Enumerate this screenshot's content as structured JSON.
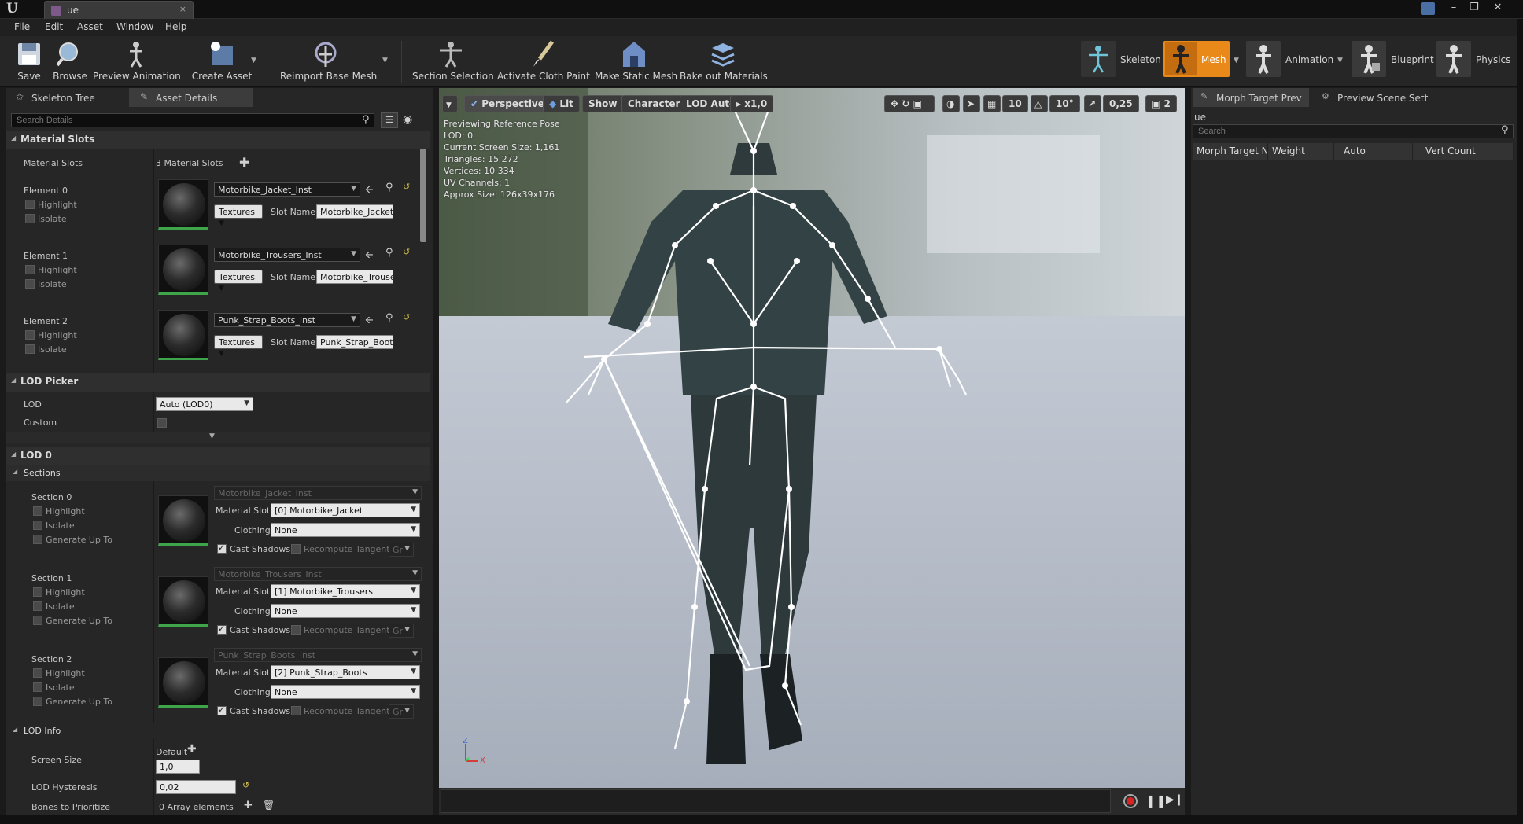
{
  "window": {
    "tab_title": "ue",
    "tab_close": "×",
    "logo": "U",
    "minimize": "–",
    "restore": "❒",
    "close": "✕"
  },
  "menu": [
    "File",
    "Edit",
    "Asset",
    "Window",
    "Help"
  ],
  "toolbar": {
    "buttons": [
      "Save",
      "Browse",
      "Preview Animation",
      "Create Asset",
      "Reimport Base Mesh",
      "Section Selection",
      "Activate Cloth Paint",
      "Make Static Mesh",
      "Bake out Materials"
    ],
    "modes": [
      "Skeleton",
      "Mesh",
      "Animation",
      "Blueprint",
      "Physics"
    ],
    "active_mode": "Mesh",
    "accent_color": "#e8891a"
  },
  "left_panel": {
    "tabs": [
      "Skeleton Tree",
      "Asset Details"
    ],
    "search_placeholder": "Search Details",
    "material_slots": {
      "header": "Material Slots",
      "row_label": "Material Slots",
      "count": "3 Material Slots",
      "elements": [
        {
          "label": "Element 0",
          "material": "Motorbike_Jacket_Inst",
          "slot_name": "Motorbike_Jacket"
        },
        {
          "label": "Element 1",
          "material": "Motorbike_Trousers_Inst",
          "slot_name": "Motorbike_Trouse"
        },
        {
          "label": "Element 2",
          "material": "Punk_Strap_Boots_Inst",
          "slot_name": "Punk_Strap_Boots"
        }
      ],
      "highlight": "Highlight",
      "isolate": "Isolate",
      "textures": "Textures",
      "slot_name_label": "Slot Name"
    },
    "lod_picker": {
      "header": "LOD Picker",
      "lod_label": "LOD",
      "lod_value": "Auto (LOD0)",
      "custom_label": "Custom"
    },
    "lod0": {
      "header": "LOD 0",
      "sections_header": "Sections",
      "sections": [
        {
          "label": "Section 0",
          "material": "Motorbike_Jacket_Inst",
          "slot": "[0] Motorbike_Jacket",
          "clothing": "None"
        },
        {
          "label": "Section 1",
          "material": "Motorbike_Trousers_Inst",
          "slot": "[1] Motorbike_Trousers",
          "clothing": "None"
        },
        {
          "label": "Section 2",
          "material": "Punk_Strap_Boots_Inst",
          "slot": "[2] Punk_Strap_Boots",
          "clothing": "None"
        }
      ],
      "generate_up_to": "Generate Up To",
      "material_slot_label": "Material Slot",
      "clothing_label": "Clothing",
      "cast_shadows": "Cast Shadows",
      "recompute_tangent": "Recompute Tangent",
      "gr": "Gr",
      "lod_info": {
        "header": "LOD Info",
        "screen_size_label": "Screen Size",
        "screen_size_default": "Default",
        "screen_size_value": "1,0",
        "hysteresis_label": "LOD Hysteresis",
        "hysteresis_value": "0,02",
        "bones_label": "Bones to Prioritize",
        "bones_value": "0 Array elements"
      }
    }
  },
  "viewport": {
    "toolbar": {
      "perspective": "Perspective",
      "lit": "Lit",
      "show": "Show",
      "character": "Character",
      "lod": "LOD Auto",
      "speed": "x1,0",
      "grid": "10",
      "angle": "10°",
      "scale": "0,25",
      "cam_speed": "2"
    },
    "info": [
      "Previewing Reference Pose",
      "LOD: 0",
      "Current Screen Size: 1,161",
      "Triangles: 15 272",
      "Vertices: 10 334",
      "UV Channels: 1",
      "Approx Size: 126x39x176"
    ],
    "axis": {
      "z": "Z",
      "x": "X"
    }
  },
  "right_panel": {
    "tabs": [
      "Morph Target Prev",
      "Preview Scene Sett"
    ],
    "asset_name": "ue",
    "search_placeholder": "Search",
    "columns": [
      "Morph Target Na",
      "Weight",
      "Auto",
      "Vert Count"
    ]
  }
}
